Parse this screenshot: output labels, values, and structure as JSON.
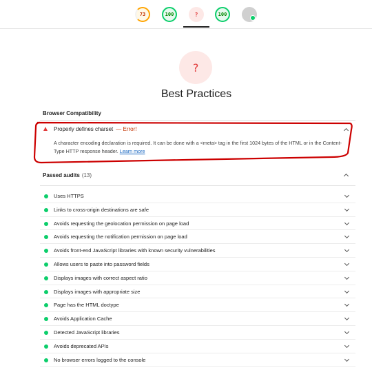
{
  "top_gauges": [
    {
      "score": "73",
      "status": "average"
    },
    {
      "score": "100",
      "status": "pass"
    },
    {
      "score": "?",
      "status": "error"
    },
    {
      "score": "100",
      "status": "pass"
    },
    {
      "score": "",
      "status": "pwa",
      "icon": "pwa-badge-icon"
    }
  ],
  "category": {
    "score": "?",
    "title": "Best Practices"
  },
  "browser_compat": {
    "header": "Browser Compatibility",
    "failed_audit": {
      "title": "Properly defines charset",
      "status": "— Error!",
      "description": "A character encoding declaration is required. It can be done with a <meta> tag in the first 1024 bytes of the HTML or in the Content-Type HTTP response header.",
      "link": "Learn more"
    }
  },
  "passed_audits": {
    "header": "Passed audits",
    "count": "(13)",
    "items": [
      "Uses HTTPS",
      "Links to cross-origin destinations are safe",
      "Avoids requesting the geolocation permission on page load",
      "Avoids requesting the notification permission on page load",
      "Avoids front-end JavaScript libraries with known security vulnerabilities",
      "Allows users to paste into password fields",
      "Displays images with correct aspect ratio",
      "Displays images with appropriate size",
      "Page has the HTML doctype",
      "Avoids Application Cache",
      "Detected JavaScript libraries",
      "Avoids deprecated APIs",
      "No browser errors logged to the console"
    ]
  },
  "colors": {
    "pass": "#0cce6b",
    "average": "#ffa400",
    "fail": "#e13b3b",
    "annotation": "#cc0000"
  }
}
